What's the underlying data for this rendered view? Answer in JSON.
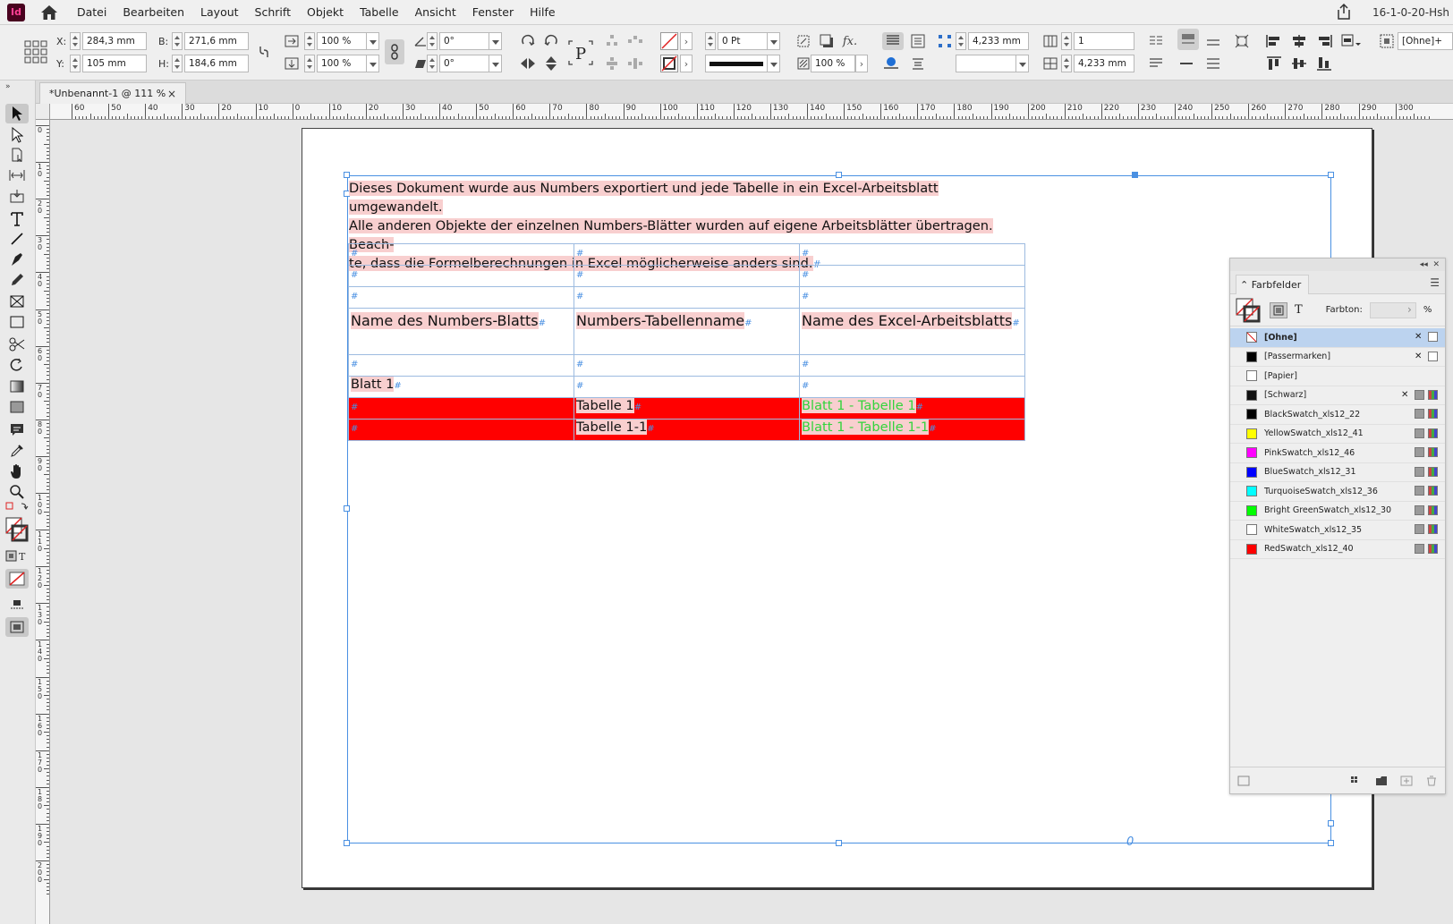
{
  "app": {
    "icon_text": "Id",
    "document_name_right": "16-1-0-20-Hsh"
  },
  "menu": [
    "Datei",
    "Bearbeiten",
    "Layout",
    "Schrift",
    "Objekt",
    "Tabelle",
    "Ansicht",
    "Fenster",
    "Hilfe"
  ],
  "control_panel": {
    "x_label": "X:",
    "x_value": "284,3 mm",
    "y_label": "Y:",
    "y_value": "105 mm",
    "w_label": "B:",
    "w_value": "271,6 mm",
    "h_label": "H:",
    "h_value": "184,6 mm",
    "scale_x": "100 %",
    "scale_y": "100 %",
    "rotate": "0°",
    "shear": "0°",
    "stroke_weight": "0 Pt",
    "opacity": "100 %",
    "inset": "4,233 mm",
    "columns": "1",
    "gutter": "4,233 mm",
    "style_label": "[Ohne]+"
  },
  "tab": {
    "title": "*Unbenannt-1 @ 111 %",
    "close": "×"
  },
  "ruler_h": [
    "60",
    "50",
    "40",
    "30",
    "20",
    "10",
    "0",
    "10",
    "20",
    "30",
    "40",
    "50",
    "60",
    "70",
    "80",
    "90",
    "100",
    "110",
    "120",
    "130",
    "140",
    "150",
    "160",
    "170",
    "180",
    "190",
    "200",
    "210",
    "220",
    "230",
    "240",
    "250",
    "260",
    "270",
    "280",
    "290",
    "300"
  ],
  "ruler_v": [
    "0",
    "1 0",
    "2 0",
    "3 0",
    "4 0",
    "5 0",
    "6 0",
    "7 0",
    "8 0",
    "9 0",
    "1 0 0",
    "1 1 0",
    "1 2 0",
    "1 3 0",
    "1 4 0",
    "1 5 0",
    "1 6 0",
    "1 7 0",
    "1 8 0",
    "1 9 0",
    "2 0 0"
  ],
  "document": {
    "intro": {
      "line1": "Dieses Dokument wurde aus Numbers exportiert und jede Tabelle in ein Excel-Arbeitsblatt umgewandelt.",
      "line2": "Alle anderen Objekte der einzelnen Numbers-Blätter wurden auf eigene Arbeitsblätter übertragen. Beach-",
      "line3": "te, dass die Formelberechnungen in Excel möglicherweise anders sind.",
      "end_mark": "#"
    },
    "table": {
      "cell_mark": "#",
      "headers": [
        "Name des Numbers-Blatts",
        "Numbers-Tabellenname",
        "Name des Excel-Arbeitsblatts"
      ],
      "sheet_row": "Blatt 1",
      "rows": [
        {
          "table_name": "Tabelle 1",
          "excel_name": "Blatt 1 - Tabelle 1"
        },
        {
          "table_name": "Tabelle 1-1",
          "excel_name": "Blatt 1 - Tabelle 1-1"
        }
      ]
    },
    "overset_glyph": "0"
  },
  "swatches_panel": {
    "title": "Farbfelder",
    "tint_label": "Farbton:",
    "tint_unit": "%",
    "swatches": [
      {
        "name": "[Ohne]",
        "color": "none",
        "selected": true
      },
      {
        "name": "[Passermarken]",
        "color": "#000000",
        "selected": false
      },
      {
        "name": "[Papier]",
        "color": "#ffffff",
        "selected": false
      },
      {
        "name": "[Schwarz]",
        "color": "#111111",
        "selected": false
      },
      {
        "name": "BlackSwatch_xls12_22",
        "color": "#000000",
        "selected": false
      },
      {
        "name": "YellowSwatch_xls12_41",
        "color": "#ffff00",
        "selected": false
      },
      {
        "name": "PinkSwatch_xls12_46",
        "color": "#ff00ff",
        "selected": false
      },
      {
        "name": "BlueSwatch_xls12_31",
        "color": "#0000ff",
        "selected": false
      },
      {
        "name": "TurquoiseSwatch_xls12_36",
        "color": "#00ffff",
        "selected": false
      },
      {
        "name": "Bright GreenSwatch_xls12_30",
        "color": "#00ff00",
        "selected": false
      },
      {
        "name": "WhiteSwatch_xls12_35",
        "color": "#ffffff",
        "selected": false
      },
      {
        "name": "RedSwatch_xls12_40",
        "color": "#ff0000",
        "selected": false
      }
    ]
  },
  "colors": {
    "selection_blue": "#4a90e2",
    "highlight_pink": "#f8cfcf",
    "table_red": "#ff0000",
    "text_green": "#33d43c"
  }
}
